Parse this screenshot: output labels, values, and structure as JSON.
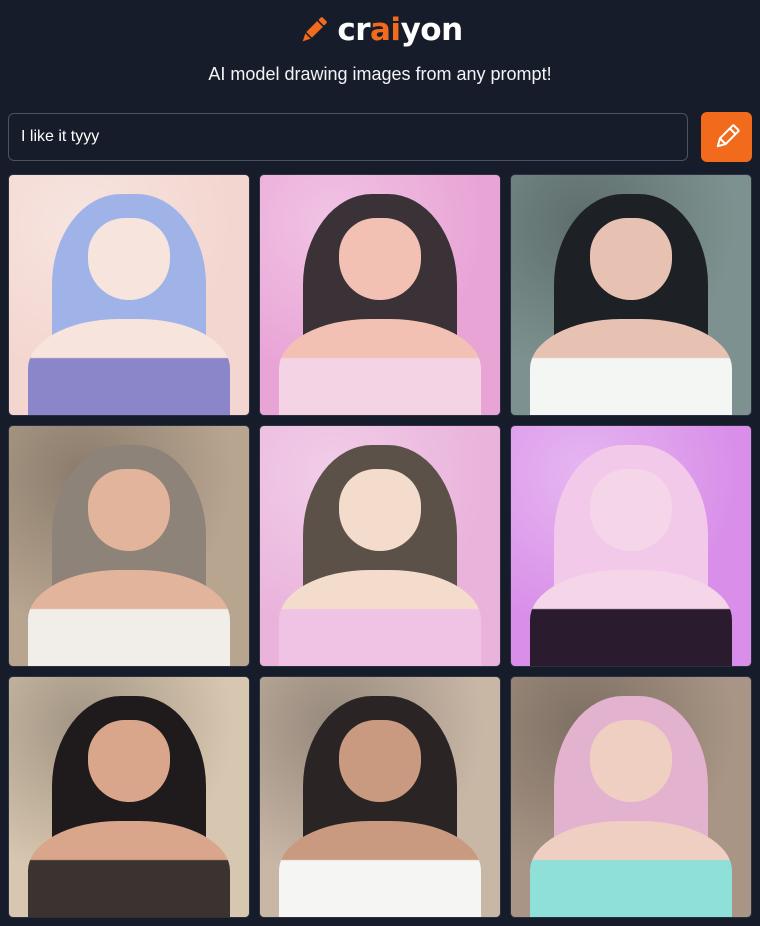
{
  "logo": {
    "prefix": "cr",
    "accent": "ai",
    "suffix": "yon",
    "icon": "pencil-icon",
    "accent_color": "#f26b1d"
  },
  "tagline": "AI model drawing images from any prompt!",
  "prompt": {
    "value": "I like it tyyy",
    "draw_icon": "pencil-icon",
    "button_color": "#f26b1d"
  },
  "results": [
    {
      "style": "anime-drawing",
      "bg": "#f3d6cf",
      "hair": "#9fb3e8",
      "skin": "#f7e4dc",
      "body": "#8b86c9"
    },
    {
      "style": "anime-drawing",
      "bg": "#e9a4d6",
      "hair": "#3a3236",
      "skin": "#f2c1b4",
      "body": "#f4d4e4"
    },
    {
      "style": "photo",
      "bg": "#7d9290",
      "hair": "#1d2126",
      "skin": "#e7c2b3",
      "body": "#f4f6f3"
    },
    {
      "style": "photo",
      "bg": "#b8a590",
      "hair": "#8e8378",
      "skin": "#e2b49c",
      "body": "#f1ede8"
    },
    {
      "style": "anime-drawing",
      "bg": "#eab3dc",
      "hair": "#5b5148",
      "skin": "#f4dccd",
      "body": "#f0c2e3"
    },
    {
      "style": "anime-drawing",
      "bg": "#d98fe9",
      "hair": "#f3c9ea",
      "skin": "#f4d6e8",
      "body": "#2a1c2e"
    },
    {
      "style": "photo",
      "bg": "#d8c7b0",
      "hair": "#1f1b1c",
      "skin": "#d9a68c",
      "body": "#3b3330"
    },
    {
      "style": "photo",
      "bg": "#c9b7a6",
      "hair": "#2a2524",
      "skin": "#c99a80",
      "body": "#f5f5f3"
    },
    {
      "style": "photo",
      "bg": "#a89585",
      "hair": "#e3b2cf",
      "skin": "#f0cfc3",
      "body": "#8fe0d8"
    }
  ]
}
